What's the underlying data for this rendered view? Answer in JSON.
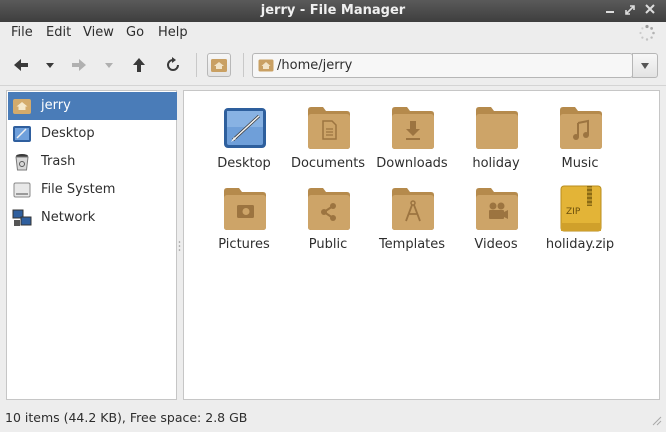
{
  "window": {
    "title": "jerry - File Manager"
  },
  "menu": [
    "File",
    "Edit",
    "View",
    "Go",
    "Help"
  ],
  "toolbar": {
    "location": "/home/jerry"
  },
  "sidebar": {
    "items": [
      {
        "label": "jerry",
        "icon": "home-folder-icon",
        "active": true
      },
      {
        "label": "Desktop",
        "icon": "desktop-icon"
      },
      {
        "label": "Trash",
        "icon": "trash-icon"
      },
      {
        "label": "File System",
        "icon": "drive-icon"
      },
      {
        "label": "Network",
        "icon": "network-icon"
      }
    ]
  },
  "files": [
    {
      "name": "Desktop",
      "icon": "desktop-folder-icon"
    },
    {
      "name": "Documents",
      "icon": "documents-folder-icon"
    },
    {
      "name": "Downloads",
      "icon": "downloads-folder-icon"
    },
    {
      "name": "holiday",
      "icon": "folder-icon"
    },
    {
      "name": "Music",
      "icon": "music-folder-icon"
    },
    {
      "name": "Pictures",
      "icon": "pictures-folder-icon"
    },
    {
      "name": "Public",
      "icon": "public-folder-icon"
    },
    {
      "name": "Templates",
      "icon": "templates-folder-icon"
    },
    {
      "name": "Videos",
      "icon": "videos-folder-icon"
    },
    {
      "name": "holiday.zip",
      "icon": "zip-archive-icon"
    }
  ],
  "status": "10 items (44.2 KB), Free space: 2.8 GB",
  "colors": {
    "selection": "#4a7cb8",
    "folder": "#c9a063",
    "titlebar": "#4a4a4a"
  }
}
